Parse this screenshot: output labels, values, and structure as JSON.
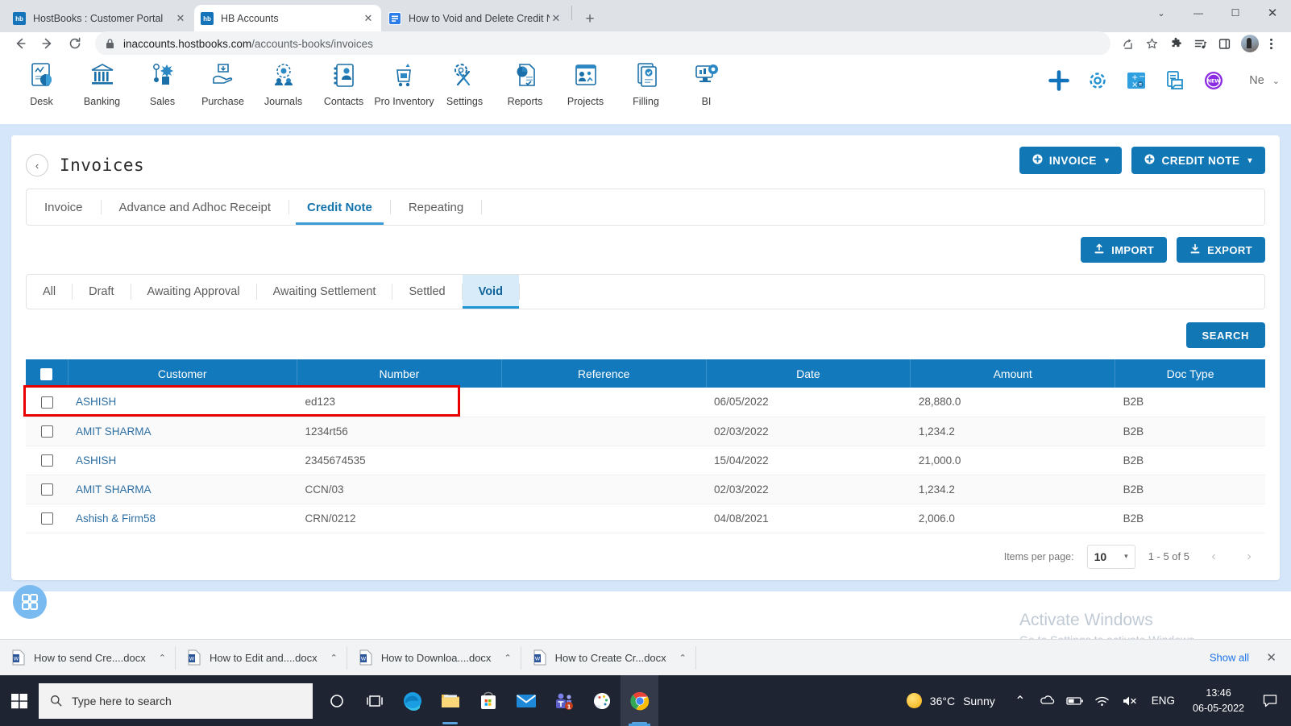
{
  "browser": {
    "tabs": [
      {
        "title": "HostBooks : Customer Portal",
        "favicon": "hb-icon",
        "active": false,
        "close": "✕"
      },
      {
        "title": "HB Accounts",
        "favicon": "hb-icon",
        "active": true,
        "close": "✕"
      },
      {
        "title": "How to Void and Delete Credit N",
        "favicon": "doc-icon",
        "active": false,
        "close": "✕"
      }
    ],
    "new_tab_label": "+",
    "window_controls": {
      "chevron": "⌄",
      "minimize": "—",
      "maximize": "☐",
      "close": "✕"
    },
    "nav": {
      "back": "←",
      "forward": "→",
      "reload": "↻"
    },
    "url_secure": "inaccounts.hostbooks.com",
    "url_path": "/accounts-books/invoices",
    "toolbar_icons": [
      "share-icon",
      "bookmark-star-icon",
      "extensions-puzzle-icon",
      "media-list-icon",
      "sidepanel-icon",
      "profile-avatar",
      "more-menu-icon"
    ]
  },
  "appnav": {
    "items": [
      {
        "label": "Desk",
        "icon": "desk-icon"
      },
      {
        "label": "Banking",
        "icon": "bank-icon"
      },
      {
        "label": "Sales",
        "icon": "sales-icon"
      },
      {
        "label": "Purchase",
        "icon": "purchase-icon"
      },
      {
        "label": "Journals",
        "icon": "journals-icon"
      },
      {
        "label": "Contacts",
        "icon": "contacts-icon"
      },
      {
        "label": "Pro Inventory",
        "icon": "inventory-icon"
      },
      {
        "label": "Settings",
        "icon": "settings-tools-icon"
      },
      {
        "label": "Reports",
        "icon": "reports-icon"
      },
      {
        "label": "Projects",
        "icon": "projects-icon"
      },
      {
        "label": "Filling",
        "icon": "filling-icon"
      },
      {
        "label": "BI",
        "icon": "bi-icon"
      }
    ],
    "quick_icons": [
      "add-plus-icon",
      "gear-icon",
      "calculator-icon",
      "notes-icon",
      "new-badge-icon"
    ],
    "user_label": "Ne",
    "user_caret": "⌄"
  },
  "page": {
    "back_arrow": "‹",
    "title": "Invoices",
    "actions": [
      {
        "label": "INVOICE",
        "icon": "plus-circle-icon",
        "caret": "▾"
      },
      {
        "label": "CREDIT NOTE",
        "icon": "plus-circle-icon",
        "caret": "▾"
      }
    ],
    "doc_tabs": [
      {
        "label": "Invoice",
        "active": false
      },
      {
        "label": "Advance and Adhoc Receipt",
        "active": false
      },
      {
        "label": "Credit Note",
        "active": true
      },
      {
        "label": "Repeating",
        "active": false
      }
    ],
    "io_buttons": [
      {
        "label": "IMPORT",
        "icon": "upload-icon"
      },
      {
        "label": "EXPORT",
        "icon": "download-icon"
      }
    ],
    "status_tabs": [
      {
        "label": "All",
        "active": false
      },
      {
        "label": "Draft",
        "active": false
      },
      {
        "label": "Awaiting Approval",
        "active": false
      },
      {
        "label": "Awaiting Settlement",
        "active": false
      },
      {
        "label": "Settled",
        "active": false
      },
      {
        "label": "Void",
        "active": true
      }
    ],
    "search_label": "SEARCH"
  },
  "table": {
    "columns": [
      "Customer",
      "Number",
      "Reference",
      "Date",
      "Amount",
      "Doc Type"
    ],
    "rows": [
      {
        "customer": "ASHISH",
        "number": "ed123",
        "reference": "",
        "date": "06/05/2022",
        "amount": "28,880.0",
        "doc_type": "B2B",
        "highlighted": true
      },
      {
        "customer": "AMIT SHARMA",
        "number": "1234rt56",
        "reference": "",
        "date": "02/03/2022",
        "amount": "1,234.2",
        "doc_type": "B2B",
        "highlighted": false
      },
      {
        "customer": "ASHISH",
        "number": "2345674535",
        "reference": "",
        "date": "15/04/2022",
        "amount": "21,000.0",
        "doc_type": "B2B",
        "highlighted": false
      },
      {
        "customer": "AMIT SHARMA",
        "number": "CCN/03",
        "reference": "",
        "date": "02/03/2022",
        "amount": "1,234.2",
        "doc_type": "B2B",
        "highlighted": false
      },
      {
        "customer": "Ashish & Firm58",
        "number": "CRN/0212",
        "reference": "",
        "date": "04/08/2021",
        "amount": "2,006.0",
        "doc_type": "B2B",
        "highlighted": false
      }
    ]
  },
  "paginator": {
    "items_per_page_label": "Items per page:",
    "items_per_page_value": "10",
    "caret": "▾",
    "range": "1 - 5 of 5",
    "prev": "‹",
    "next": "›"
  },
  "watermark": {
    "line1": "Activate Windows",
    "line2": "Go to Settings to activate Windows."
  },
  "downloads": {
    "items": [
      {
        "name": "How to send Cre....docx",
        "caret": "⌃"
      },
      {
        "name": "How to Edit and....docx",
        "caret": "⌃"
      },
      {
        "name": "How to Downloa....docx",
        "caret": "⌃"
      },
      {
        "name": "How to Create Cr...docx",
        "caret": "⌃"
      }
    ],
    "show_all": "Show all",
    "close": "✕"
  },
  "taskbar": {
    "search_placeholder": "Type here to search",
    "icons": [
      "cortana-icon",
      "task-view-icon",
      "edge-icon",
      "file-explorer-icon",
      "microsoft-store-icon",
      "mail-icon",
      "teams-icon",
      "paint-3d-icon",
      "chrome-icon"
    ],
    "teams_badge": "1",
    "weather_temp": "36°C",
    "weather_desc": "Sunny",
    "tray_chevron": "⌃",
    "language": "ENG",
    "time": "13:46",
    "date": "06-05-2022"
  },
  "colors": {
    "brand_blue": "#1379bd",
    "header_blue": "#1277b5",
    "active_tab_bg": "#d7ecf8",
    "page_bg": "#d6e6fa",
    "highlight_red": "#e80000",
    "link_blue": "#2e6fa3"
  }
}
